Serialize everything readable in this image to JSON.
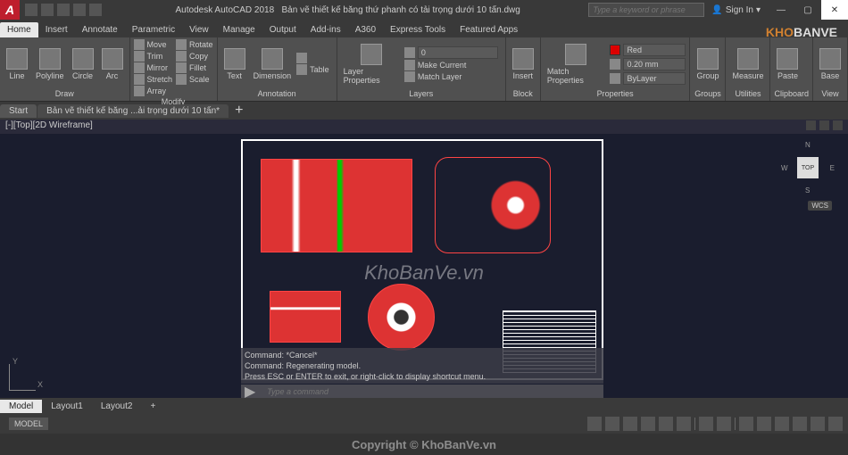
{
  "title": {
    "app": "Autodesk AutoCAD 2018",
    "file": "Bản vẽ thiết kế băng thứ phanh có tải trọng dưới 10 tấn.dwg",
    "search_placeholder": "Type a keyword or phrase",
    "signin": "Sign In"
  },
  "ribbon_tabs": [
    "Home",
    "Insert",
    "Annotate",
    "Parametric",
    "View",
    "Manage",
    "Output",
    "Add-ins",
    "A360",
    "Express Tools",
    "Featured Apps"
  ],
  "panels": {
    "draw": {
      "label": "Draw",
      "big": [
        "Line",
        "Polyline",
        "Circle",
        "Arc"
      ]
    },
    "modify": {
      "label": "Modify",
      "items": [
        "Move",
        "Rotate",
        "Trim",
        "Copy",
        "Mirror",
        "Fillet",
        "Stretch",
        "Scale",
        "Array"
      ]
    },
    "annotation": {
      "label": "Annotation",
      "big": [
        "Text",
        "Dimension"
      ],
      "items": [
        "Table"
      ]
    },
    "layers": {
      "label": "Layers",
      "big": "Layer Properties",
      "items": [
        "Make Current",
        "Match Layer"
      ]
    },
    "block": {
      "label": "Block",
      "big": "Insert"
    },
    "properties": {
      "label": "Properties",
      "big": "Match Properties",
      "color": "Red",
      "lineweight": "0.20 mm",
      "layer": "ByLayer"
    },
    "groups": {
      "label": "Groups",
      "big": "Group"
    },
    "utilities": {
      "label": "Utilities",
      "big": "Measure"
    },
    "clipboard": {
      "label": "Clipboard",
      "big": "Paste"
    },
    "view": {
      "label": "View",
      "big": "Base"
    }
  },
  "file_tabs": {
    "start": "Start",
    "current": "Bản vẽ thiết kế băng ...ải trọng dưới 10 tấn*"
  },
  "viewport": {
    "label": "[-][Top][2D Wireframe]",
    "cube": "TOP",
    "wcs": "WCS",
    "compass": {
      "n": "N",
      "s": "S",
      "e": "E",
      "w": "W"
    }
  },
  "ucs": {
    "x": "X",
    "y": "Y"
  },
  "command": {
    "lines": [
      "Command: *Cancel*",
      "Command: Regenerating model.",
      "Press ESC or ENTER to exit, or right-click to display shortcut menu."
    ],
    "prompt_placeholder": "Type a command"
  },
  "layout_tabs": [
    "Model",
    "Layout1",
    "Layout2"
  ],
  "status": {
    "mode": "MODEL"
  },
  "watermark": {
    "logo_a": "KHO",
    "logo_b": "BANVE",
    "center": "KhoBanVe.vn",
    "bottom": "Copyright © KhoBanVe.vn"
  }
}
